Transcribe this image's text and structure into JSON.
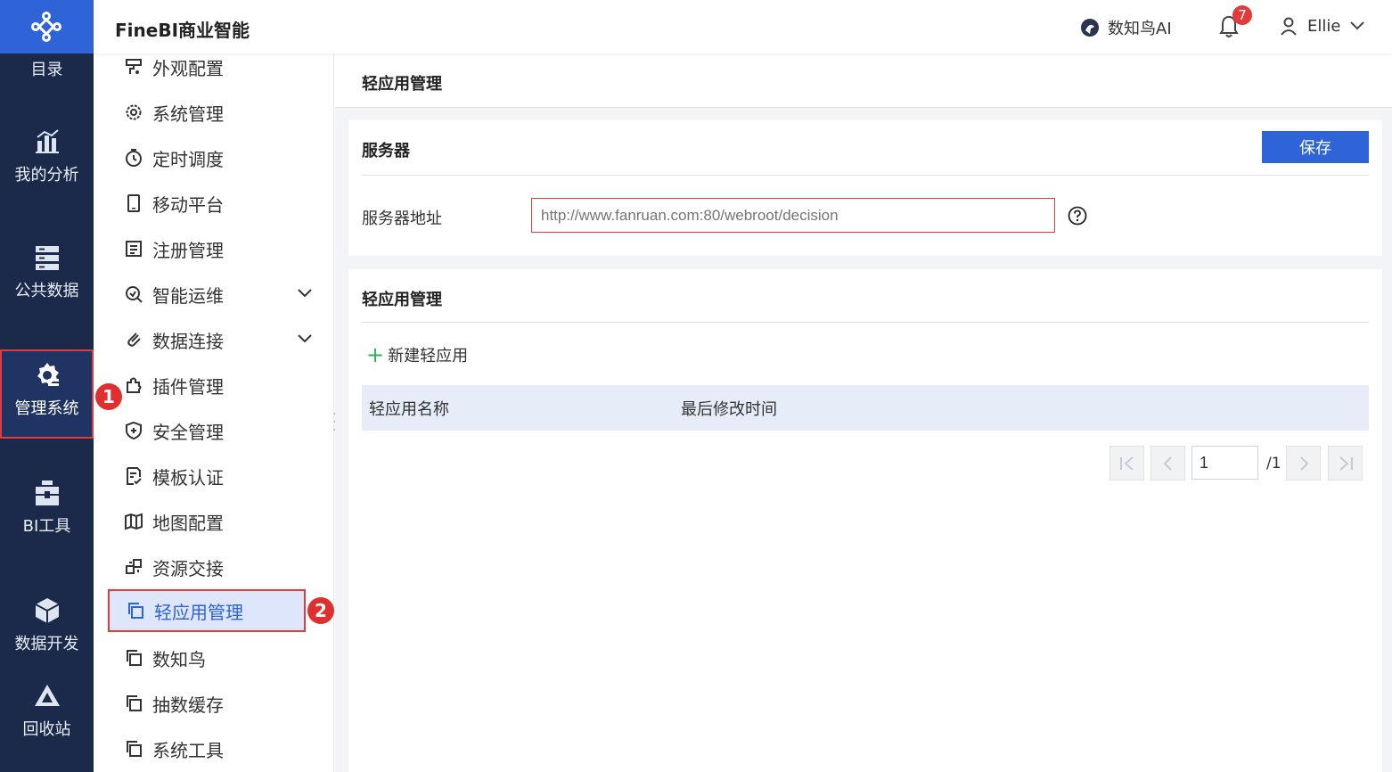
{
  "app": {
    "title": "FineBI商业智能"
  },
  "topbar": {
    "ai_label": "数知鸟AI",
    "notification_count": "7",
    "user_name": "Ellie"
  },
  "rail": {
    "items": [
      {
        "label": "目录",
        "icon": "catalog-icon"
      },
      {
        "label": "我的分析",
        "icon": "analysis-chart-icon"
      },
      {
        "label": "公共数据",
        "icon": "database-icon"
      },
      {
        "label": "管理系统",
        "icon": "gear-admin-icon",
        "active": true
      },
      {
        "label": "BI工具",
        "icon": "toolbox-icon"
      },
      {
        "label": "数据开发",
        "icon": "cube-icon"
      },
      {
        "label": "回收站",
        "icon": "recycle-icon"
      }
    ]
  },
  "menu": {
    "items": [
      {
        "label": "外观配置",
        "icon": "appearance-icon"
      },
      {
        "label": "系统管理",
        "icon": "gear-icon"
      },
      {
        "label": "定时调度",
        "icon": "timer-icon"
      },
      {
        "label": "移动平台",
        "icon": "mobile-icon"
      },
      {
        "label": "注册管理",
        "icon": "register-icon"
      },
      {
        "label": "智能运维",
        "icon": "ops-icon",
        "expandable": true
      },
      {
        "label": "数据连接",
        "icon": "link-icon",
        "expandable": true
      },
      {
        "label": "插件管理",
        "icon": "plugin-icon"
      },
      {
        "label": "安全管理",
        "icon": "shield-icon"
      },
      {
        "label": "模板认证",
        "icon": "template-icon"
      },
      {
        "label": "地图配置",
        "icon": "map-icon"
      },
      {
        "label": "资源交接",
        "icon": "transfer-icon"
      },
      {
        "label": "轻应用管理",
        "icon": "copy-icon",
        "active": true
      },
      {
        "label": "数知鸟",
        "icon": "copy-icon"
      },
      {
        "label": "抽数缓存",
        "icon": "copy-icon"
      },
      {
        "label": "系统工具",
        "icon": "copy-icon"
      }
    ]
  },
  "markers": {
    "first": "1",
    "second": "2"
  },
  "page": {
    "header": "轻应用管理",
    "server_card": {
      "title": "服务器",
      "save_label": "保存",
      "address_label": "服务器地址",
      "address_placeholder": "http://www.fanruan.com:80/webroot/decision"
    },
    "app_card": {
      "title": "轻应用管理",
      "new_label": "新建轻应用",
      "columns": [
        "轻应用名称",
        "最后修改时间"
      ]
    },
    "pagination": {
      "current": "1",
      "total": "/1"
    }
  },
  "colors": {
    "accent": "#2e64d8",
    "rail_bg": "#1b2a4a",
    "highlight": "#e23b3b",
    "add_green": "#2fb25e"
  }
}
